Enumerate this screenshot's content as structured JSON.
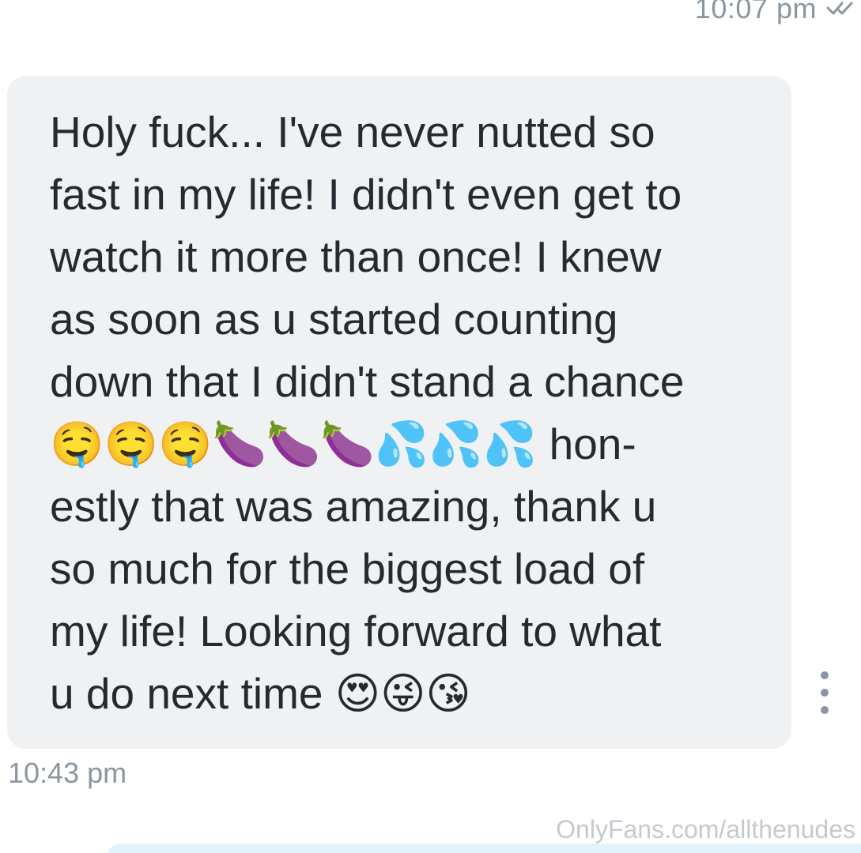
{
  "previous_message": {
    "time": "10:07 pm",
    "status_icon": "double-check-icon"
  },
  "message": {
    "text": "Holy fuck... I've never nutted so\nfast in my life! I didn't even get to\nwatch it more than once! I knew\nas soon as u started counting\ndown that I didn't stand a chance\n🤤🤤🤤🍆🍆🍆💦💦💦 hon-\nestly that was amazing, thank u\nso much for the biggest load of\nmy life! Looking forward to what\nu do next time 😍😜😘",
    "time": "10:43 pm",
    "bubble_color": "#f0f1f3",
    "text_color": "#242a30"
  },
  "more_button": {
    "icon": "vertical-ellipsis-icon"
  },
  "watermark": {
    "text": "OnlyFans.com/allthenudes"
  },
  "colors": {
    "meta_text": "#8a96a3",
    "next_bubble": "#e3f3fb"
  }
}
